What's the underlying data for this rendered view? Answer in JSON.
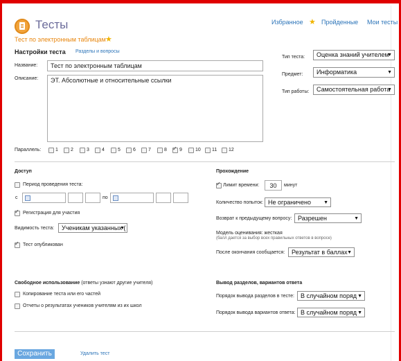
{
  "header": {
    "app_title": "Тесты",
    "nav": {
      "favorites": "Избранное",
      "completed": "Пройденные",
      "my_tests": "Мои тесты"
    },
    "test_name_link": "Тест по электронным таблицам"
  },
  "settings": {
    "title": "Настройки теста",
    "sections_link": "Разделы и вопросы",
    "name_label": "Название:",
    "name_value": "Тест по электронным таблицам",
    "description_label": "Описание:",
    "description_value": "ЭТ. Абсолютные и относительные ссылки",
    "test_type_label": "Тип теста:",
    "test_type_value": "Оценка знаний учителем",
    "subject_label": "Предмет:",
    "subject_value": "Информатика",
    "work_type_label": "Тип работы:",
    "work_type_value": "Самостоятельная работа",
    "parallels_label": "Параллель:",
    "parallels": [
      {
        "label": "1",
        "checked": false
      },
      {
        "label": "2",
        "checked": false
      },
      {
        "label": "3",
        "checked": false
      },
      {
        "label": "4",
        "checked": false
      },
      {
        "label": "5",
        "checked": false
      },
      {
        "label": "6",
        "checked": false
      },
      {
        "label": "7",
        "checked": false
      },
      {
        "label": "8",
        "checked": false
      },
      {
        "label": "9",
        "checked": true
      },
      {
        "label": "10",
        "checked": false
      },
      {
        "label": "11",
        "checked": false
      },
      {
        "label": "12",
        "checked": false
      }
    ]
  },
  "access": {
    "title": "Доступ",
    "period_label": "Период проведения теста:",
    "period_checked": false,
    "from_label": "с",
    "to_label": "по",
    "registration_label": "Регистрация для участия",
    "registration_checked": true,
    "visibility_label": "Видимость теста:",
    "visibility_value": "Ученикам указанных (",
    "published_label": "Тест опубликован",
    "published_checked": true
  },
  "passing": {
    "title": "Прохождение",
    "time_limit_label": "Лимит времени:",
    "time_limit_checked": true,
    "time_limit_value": "30",
    "time_limit_unit": "минут",
    "attempts_label": "Количество попыток:",
    "attempts_value": "Не ограничено",
    "return_label": "Возврат к предыдущему вопросу:",
    "return_value": "Разрешен",
    "grading_model": "Модель оценивания: жесткая",
    "grading_note": "(балл дается за выбор всех правильных ответов в вопросе)",
    "after_label": "После окончания сообщается:",
    "after_value": "Результат в баллах"
  },
  "free_use": {
    "title": "Свободное использование",
    "title_note": "(ответы узнают другие учителя)",
    "copy_label": "Копирование теста или его частей",
    "copy_checked": false,
    "reports_label": "Отчеты о результатах учеников учителям из их школ",
    "reports_checked": false
  },
  "output": {
    "title": "Вывод разделов, вариантов ответа",
    "sections_order_label": "Порядок вывода разделов в тесте:",
    "sections_order_value": "В случайном поряд",
    "answers_order_label": "Порядок вывода вариантов ответа:",
    "answers_order_value": "В случайном поряд"
  },
  "footer": {
    "save_label": "Сохранить",
    "delete_label": "Удалить тест"
  },
  "colors": {
    "frame": "#e00000",
    "link": "#2a73b8",
    "accent_orange": "#e8850c",
    "save_button": "#6aa7e0"
  },
  "icons": {
    "app": "document-icon",
    "favorite": "star-icon",
    "date": "calendar-icon"
  }
}
